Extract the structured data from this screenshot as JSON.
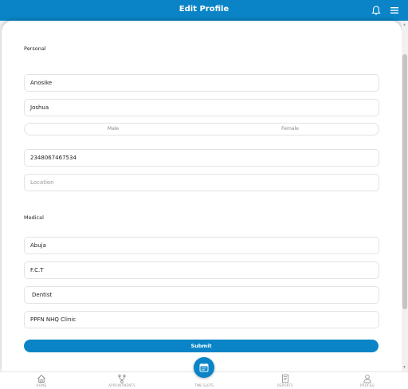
{
  "header": {
    "title": "Edit Profile",
    "notification_icon": "bell-icon",
    "menu_icon": "hamburger-menu-icon"
  },
  "personal": {
    "section_title": "Personal",
    "last_name": "Anosike",
    "first_name": "Joshua",
    "gender_options": [
      "Male",
      "Female"
    ],
    "phone": "2348067467534",
    "location_placeholder": "Location"
  },
  "medical": {
    "section_title": "Medical",
    "city": "Abuja",
    "state": "F.C.T",
    "specialty": "Dentist",
    "clinic": "PPFN NHQ Clinic"
  },
  "submit_label": "Submit",
  "nav": {
    "items": [
      {
        "label": "HOME",
        "icon": "home-icon"
      },
      {
        "label": "APPOINTMENTS",
        "icon": "appointments-icon"
      },
      {
        "label": "TIME SLOTS",
        "icon": "calendar-icon"
      },
      {
        "label": "REPORTS",
        "icon": "reports-icon"
      },
      {
        "label": "PROFILE",
        "icon": "profile-icon"
      }
    ]
  },
  "colors": {
    "primary": "#0a84c6",
    "background": "#eef0f2"
  }
}
